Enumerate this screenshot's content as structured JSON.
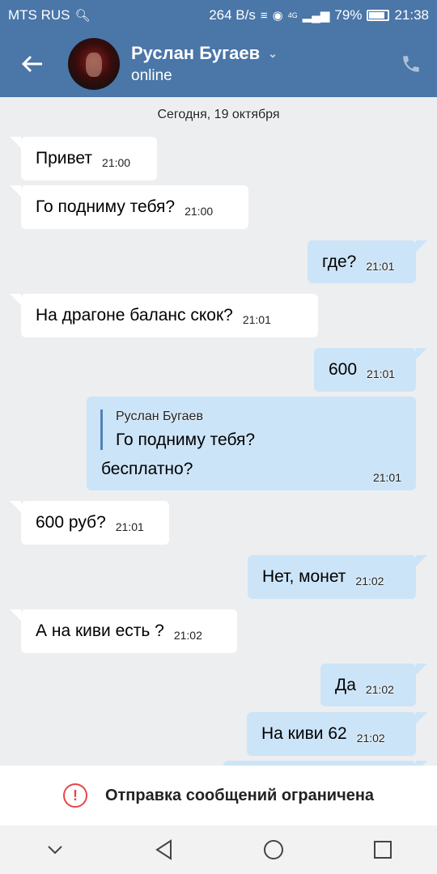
{
  "statusbar": {
    "carrier": "MTS RUS",
    "speed": "264 B/s",
    "network": "4G",
    "battery": "79%",
    "time": "21:38"
  },
  "header": {
    "name": "Руслан Бугаев",
    "status": "online"
  },
  "chat": {
    "date": "Сегодня, 19 октября",
    "messages": [
      {
        "text": "Привет",
        "time": "21:00"
      },
      {
        "text": "Го подниму тебя?",
        "time": "21:00"
      },
      {
        "text": "где?",
        "time": "21:01"
      },
      {
        "text": "На драгоне баланс скок?",
        "time": "21:01"
      },
      {
        "text": "600",
        "time": "21:01"
      },
      {
        "text": "600 руб?",
        "time": "21:01"
      },
      {
        "text": "Нет, монет",
        "time": "21:02"
      },
      {
        "text": "А на киви есть ?",
        "time": "21:02"
      },
      {
        "text": "Да",
        "time": "21:02"
      },
      {
        "text": "На киви 62",
        "time": "21:02"
      }
    ],
    "quote": {
      "author": "Руслан Бугаев",
      "quoted_text": "Го подниму тебя?",
      "text": "бесплатно?",
      "time": "21:01"
    }
  },
  "restriction": {
    "text": "Отправка сообщений ограничена"
  },
  "colors": {
    "header_bg": "#4a76a8",
    "chat_bg": "#edeef0",
    "incoming_bubble": "#ffffff",
    "outgoing_bubble": "#cce4f7",
    "warning": "#e64646"
  }
}
